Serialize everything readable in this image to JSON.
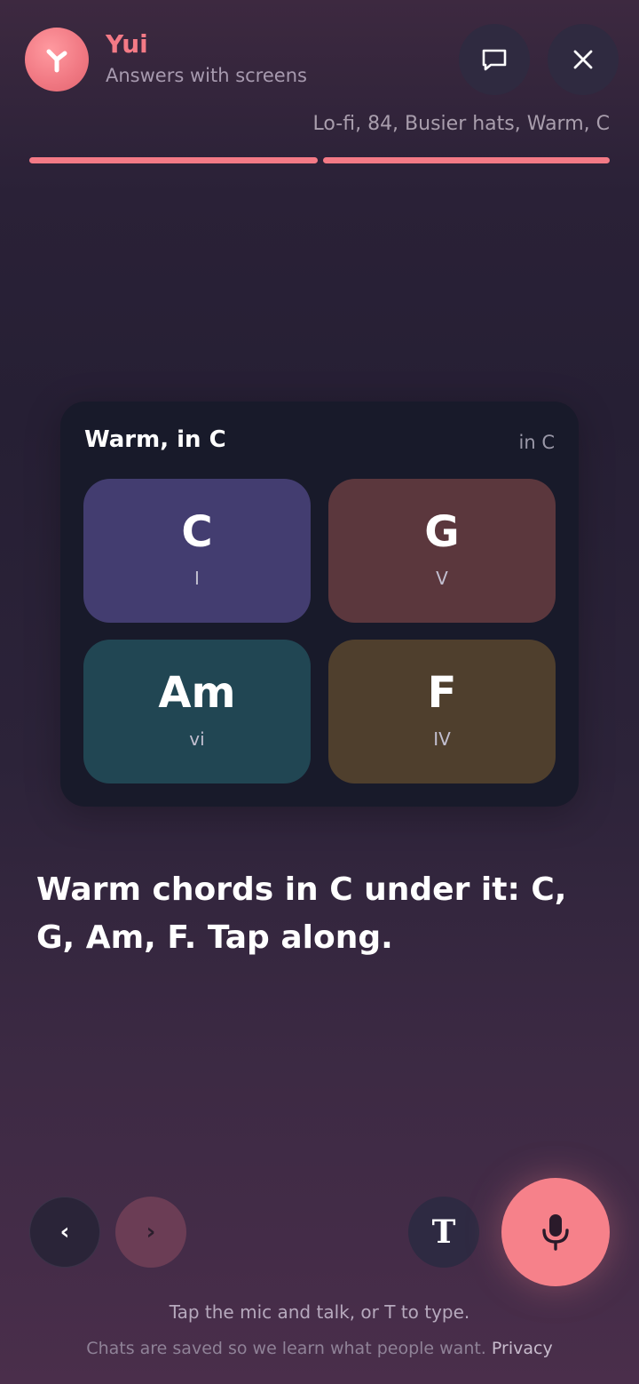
{
  "header": {
    "name": "Yui",
    "subtitle": "Answers with screens",
    "context": "Lo-fi, 84, Busier hats, Warm, C",
    "colors": {
      "accent": "#f47a86",
      "avatar": "#f17a84"
    },
    "icons": {
      "avatar": "sprout-icon",
      "chat": "chat-bubble-icon",
      "close": "close-icon"
    },
    "progress": [
      1.0,
      1.0
    ]
  },
  "card": {
    "title": "Warm, in C",
    "key": "in C",
    "chords": [
      {
        "name": "C",
        "roman": "I",
        "color": "#433d70"
      },
      {
        "name": "G",
        "roman": "V",
        "color": "#5b373d"
      },
      {
        "name": "Am",
        "roman": "vi",
        "color": "#214653"
      },
      {
        "name": "F",
        "roman": "IV",
        "color": "#4f3f2d"
      }
    ]
  },
  "message": "Warm chords in C under it: C, G, Am, F. Tap along.",
  "controls": {
    "prev_label": "‹",
    "next_label": "›",
    "type_label": "T",
    "mic_icon": "microphone-icon",
    "mic_color": "#f6818a"
  },
  "footer": {
    "hint": "Tap the mic and talk, or T to type.",
    "legal": "Chats are saved so we learn what people want.",
    "privacy_link": "Privacy"
  }
}
